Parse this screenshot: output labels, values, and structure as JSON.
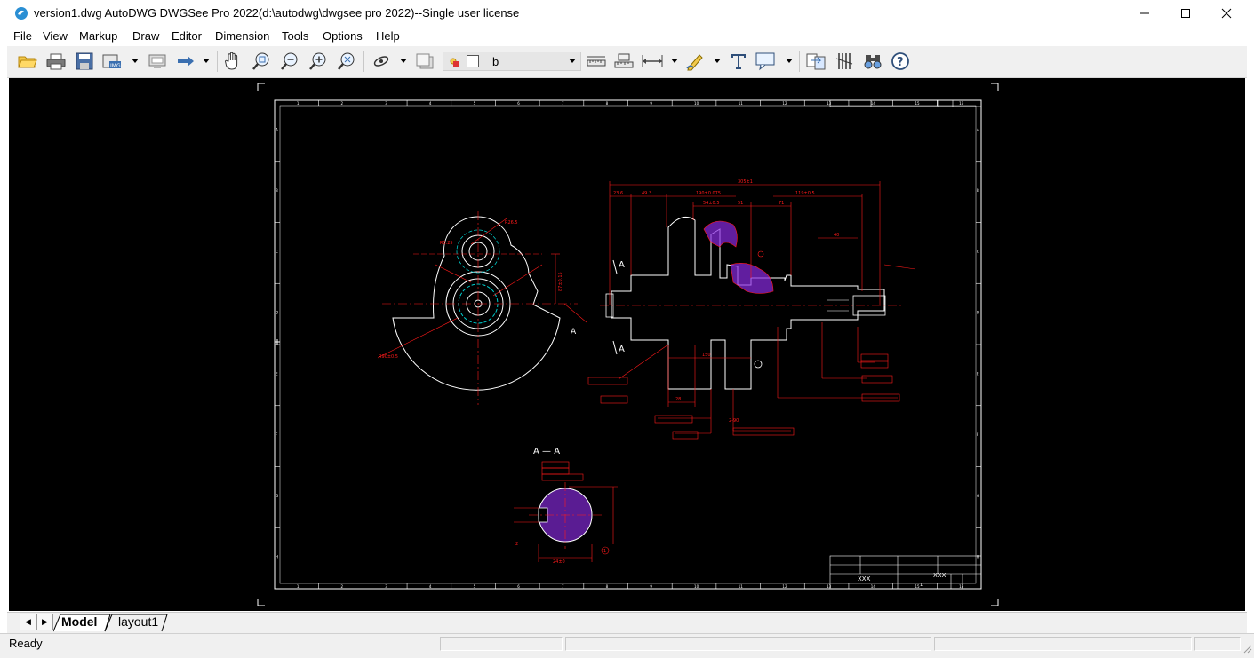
{
  "window": {
    "title": "version1.dwg AutoDWG DWGSee Pro 2022(d:\\autodwg\\dwgsee pro 2022)--Single user license",
    "minimize_glyph": "—",
    "maximize_glyph": "☐",
    "close_glyph": "✕"
  },
  "menu": [
    "File",
    "View",
    "Markup",
    "Draw",
    "Editor",
    "Dimension",
    "Tools",
    "Options",
    "Help"
  ],
  "toolbar": {
    "layer_value": "b",
    "icons": [
      "open-folder-icon",
      "print-icon",
      "save-icon",
      "export-image-icon",
      "compare-icon",
      "arrow-right-icon",
      "pan-hand-icon",
      "zoom-window-icon",
      "zoom-out-icon",
      "zoom-in-icon",
      "zoom-extents-icon",
      "layer-icon",
      "layer-state-icon",
      "measure-distance-icon",
      "measure-area-icon",
      "measure-arrow-icon",
      "markup-pen-icon",
      "text-icon",
      "callout-icon",
      "compare-drawings-icon",
      "bars-icon",
      "find-binoculars-icon",
      "help-icon"
    ]
  },
  "drawing": {
    "section_label": "A — A",
    "section_mark_left": "A",
    "section_mark_right": "A",
    "dimension_labels": {
      "overall_length": "305±1",
      "d_236": "23.6",
      "d_493": "49.3",
      "d_190": "190±0.075",
      "d_119": "119±0.5",
      "d_54": "54±0.5",
      "d_51": "51",
      "d_71": "71",
      "d_40": "40",
      "r_d2": "R26.5",
      "r_d1": "R3.25",
      "radius_big": "R90±0.5",
      "chord": "2-90",
      "d_245": "24±0",
      "d_28": "28",
      "d_150": "150",
      "d_87": "87±0.15",
      "d_1": "1",
      "d_2": "2"
    },
    "title_block": {
      "designer": "XXX",
      "checker": "XXX",
      "sheet": "1"
    },
    "border_letters": [
      "A",
      "B",
      "C",
      "D",
      "E",
      "F",
      "G",
      "H"
    ],
    "border_numbers": [
      "1",
      "2",
      "3",
      "4",
      "5",
      "6",
      "7",
      "8",
      "9",
      "10",
      "11",
      "12",
      "13",
      "14",
      "15",
      "16"
    ]
  },
  "tabs": {
    "prev_glyph": "◀",
    "next_glyph": "▶",
    "items": [
      "Model",
      "layout1"
    ]
  },
  "status": {
    "text": "Ready"
  },
  "colors": {
    "canvas": "#000000",
    "drawing_white": "#ffffff",
    "dimension_red": "#ff1a1a",
    "hatch_magenta": "#8a2be2",
    "centerline_cyan": "#00cccc"
  }
}
